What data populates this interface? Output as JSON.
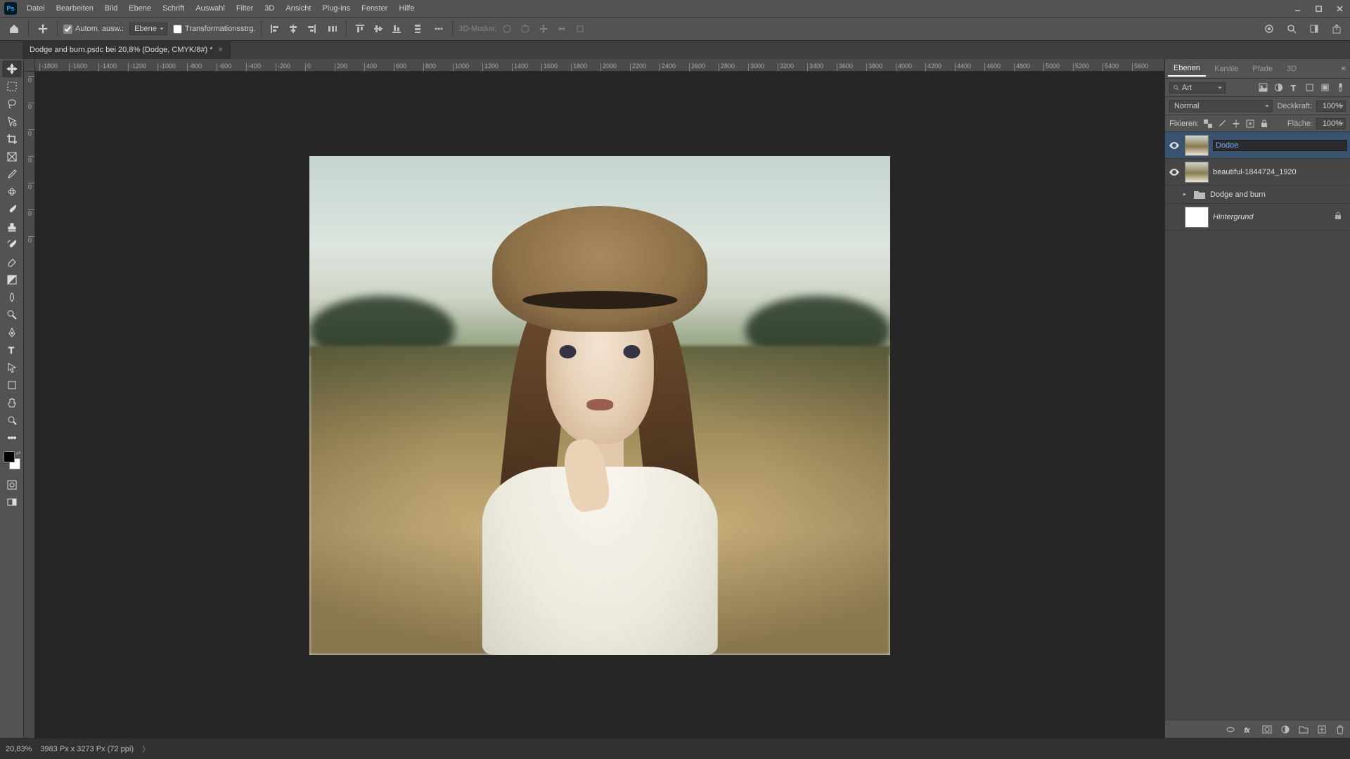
{
  "menu": {
    "items": [
      "Datei",
      "Bearbeiten",
      "Bild",
      "Ebene",
      "Schrift",
      "Auswahl",
      "Filter",
      "3D",
      "Ansicht",
      "Plug-ins",
      "Fenster",
      "Hilfe"
    ]
  },
  "options": {
    "auto_select_label": "Autom. ausw.:",
    "layer_dropdown": "Ebene",
    "transform_label": "Transformationsstrg.",
    "mode3d_label": "3D-Modus:"
  },
  "document": {
    "tab_title": "Dodge and burn.psdc bei 20,8% (Dodge, CMYK/8#) *",
    "zoom": "20,83%",
    "dimensions": "3983 Px x 3273 Px (72 ppi)"
  },
  "ruler_h": [
    "-1800",
    "-1600",
    "-1400",
    "-1200",
    "-1000",
    "-800",
    "-600",
    "-400",
    "-200",
    "0",
    "200",
    "400",
    "600",
    "800",
    "1000",
    "1200",
    "1400",
    "1600",
    "1800",
    "2000",
    "2200",
    "2400",
    "2600",
    "2800",
    "3000",
    "3200",
    "3400",
    "3600",
    "3800",
    "4000",
    "4200",
    "4400",
    "4600",
    "4800",
    "5000",
    "5200",
    "5400",
    "5600"
  ],
  "ruler_v": [
    "0",
    "0",
    "0",
    "0",
    "0",
    "0",
    "0"
  ],
  "panels": {
    "tabs": [
      "Ebenen",
      "Kanäle",
      "Pfade",
      "3D"
    ],
    "filter_label": "Art",
    "blend_mode": "Normal",
    "opacity_label": "Deckkraft:",
    "opacity_value": "100%",
    "lock_label": "Fixieren:",
    "fill_label": "Fläche:",
    "fill_value": "100%"
  },
  "layers": [
    {
      "name_editing": "Dodoe",
      "visible": true,
      "thumb": "photo",
      "selected": true
    },
    {
      "name": "beautiful-1844724_1920",
      "visible": true,
      "thumb": "photo"
    },
    {
      "name": "Dodge and burn",
      "visible": false,
      "thumb": "folder",
      "group": true
    },
    {
      "name": "Hintergrund",
      "visible": false,
      "thumb": "white",
      "locked": true,
      "italic": true
    }
  ],
  "icons": {
    "filter_types": [
      "image-filter",
      "fx-filter",
      "text-filter",
      "shape-filter",
      "smart-filter"
    ],
    "lock_types": [
      "lock-pixels",
      "lock-position",
      "lock-artboard",
      "lock-nested",
      "lock-all"
    ],
    "footer": [
      "link-icon",
      "fx-icon",
      "mask-icon",
      "adjustment-icon",
      "group-icon",
      "new-layer-icon",
      "trash-icon"
    ]
  }
}
